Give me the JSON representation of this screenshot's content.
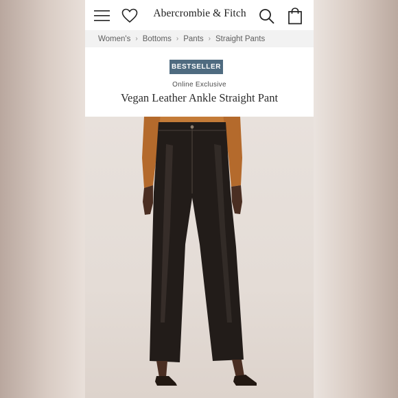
{
  "header": {
    "brand": "Abercrombie & Fitch",
    "icons": [
      "menu-icon",
      "heart-icon",
      "search-icon",
      "shopping-bag-icon"
    ]
  },
  "breadcrumb": [
    "Women's",
    "Bottoms",
    "Pants",
    "Straight Pants"
  ],
  "product": {
    "badge": "BESTSELLER",
    "availability": "Online Exclusive",
    "name": "Vegan Leather Ankle Straight Pant"
  },
  "colors": {
    "badge_background": "#4f6b80",
    "breadcrumb_background": "#f2f2f2",
    "product_color": "#1f1a17"
  }
}
